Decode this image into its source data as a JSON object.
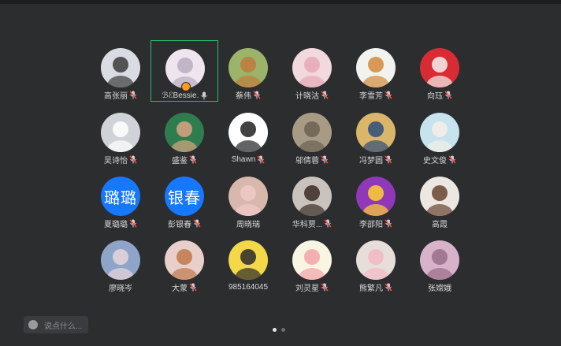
{
  "participants": [
    {
      "name": "高张丽",
      "mic": "muted",
      "avatar": {
        "kind": "photo",
        "bg": "#d9dde3",
        "fg": "#3b3b3b"
      }
    },
    {
      "name": "ℬℰBessie.",
      "mic": "on",
      "active": true,
      "host": true,
      "avatar": {
        "kind": "photo",
        "bg": "#efe5ee",
        "fg": "#b9aebf"
      }
    },
    {
      "name": "蔡伟",
      "mic": "muted",
      "avatar": {
        "kind": "photo",
        "bg": "#9bb46a",
        "fg": "#c07a3a"
      }
    },
    {
      "name": "计晓沽",
      "mic": "muted",
      "avatar": {
        "kind": "photo",
        "bg": "#f1d9de",
        "fg": "#e7a8b5"
      }
    },
    {
      "name": "李雪芳",
      "mic": "muted",
      "avatar": {
        "kind": "photo",
        "bg": "#f2f2ee",
        "fg": "#d38a3b"
      }
    },
    {
      "name": "向珏",
      "mic": "muted",
      "avatar": {
        "kind": "photo",
        "bg": "#d92b33",
        "fg": "#f3f1ee"
      }
    },
    {
      "name": "吴诗怡",
      "mic": "muted",
      "avatar": {
        "kind": "photo",
        "bg": "#cfd3d8",
        "fg": "#ffffff"
      }
    },
    {
      "name": "盛鉴",
      "mic": "muted",
      "avatar": {
        "kind": "photo",
        "bg": "#2f7c4f",
        "fg": "#d9a582"
      }
    },
    {
      "name": "Shawn",
      "mic": "muted",
      "avatar": {
        "kind": "photo",
        "bg": "#ffffff",
        "fg": "#222222"
      }
    },
    {
      "name": "邬倩蓉",
      "mic": "muted",
      "avatar": {
        "kind": "photo",
        "bg": "#a89b86",
        "fg": "#6c6152"
      }
    },
    {
      "name": "冯梦圆",
      "mic": "muted",
      "avatar": {
        "kind": "photo",
        "bg": "#d9b66a",
        "fg": "#2e4d7a"
      }
    },
    {
      "name": "史文俊",
      "mic": "muted",
      "avatar": {
        "kind": "photo",
        "bg": "#c6e3ee",
        "fg": "#f4efe6"
      }
    },
    {
      "name": "夏璐璐",
      "mic": "muted",
      "avatar": {
        "kind": "text",
        "text": "璐璐",
        "bg": "#1677ff"
      }
    },
    {
      "name": "彭银春",
      "mic": "muted",
      "avatar": {
        "kind": "text",
        "text": "银春",
        "bg": "#1677ff"
      }
    },
    {
      "name": "周晓瑞",
      "mic": "none",
      "avatar": {
        "kind": "photo",
        "bg": "#d8b8ad",
        "fg": "#f1c9c7"
      }
    },
    {
      "name": "华科贾...",
      "mic": "muted",
      "avatar": {
        "kind": "photo",
        "bg": "#c9c2bd",
        "fg": "#3a2c27"
      }
    },
    {
      "name": "李邵阳",
      "mic": "muted",
      "avatar": {
        "kind": "photo",
        "bg": "#8f38b8",
        "fg": "#ffd231"
      }
    },
    {
      "name": "高霞",
      "mic": "none",
      "avatar": {
        "kind": "photo",
        "bg": "#ece7e1",
        "fg": "#6a4330"
      }
    },
    {
      "name": "廖晓岑",
      "mic": "none",
      "avatar": {
        "kind": "photo",
        "bg": "#8fa4c9",
        "fg": "#e7d6dc"
      }
    },
    {
      "name": "大蒙",
      "mic": "muted",
      "avatar": {
        "kind": "photo",
        "bg": "#e9cfc9",
        "fg": "#c0784b"
      }
    },
    {
      "name": "985164045",
      "mic": "none",
      "avatar": {
        "kind": "photo",
        "bg": "#f3d84a",
        "fg": "#2a2a2a"
      }
    },
    {
      "name": "刘灵星",
      "mic": "muted",
      "avatar": {
        "kind": "photo",
        "bg": "#f9f5e3",
        "fg": "#f3a3a8"
      }
    },
    {
      "name": "熊繁凡",
      "mic": "muted",
      "avatar": {
        "kind": "photo",
        "bg": "#e7ded9",
        "fg": "#f2b9c4"
      }
    },
    {
      "name": "张嫦娥",
      "mic": "none",
      "avatar": {
        "kind": "photo",
        "bg": "#d7b2c8",
        "fg": "#9a6d88"
      }
    }
  ],
  "chat": {
    "placeholder": "说点什么..."
  },
  "pagination": {
    "pages": 2,
    "current": 1
  },
  "colors": {
    "background": "#2c2d2f",
    "active_border": "#2fb86a",
    "muted_icon": "#ff4d4f",
    "mic_on": "#d0d0d0"
  }
}
